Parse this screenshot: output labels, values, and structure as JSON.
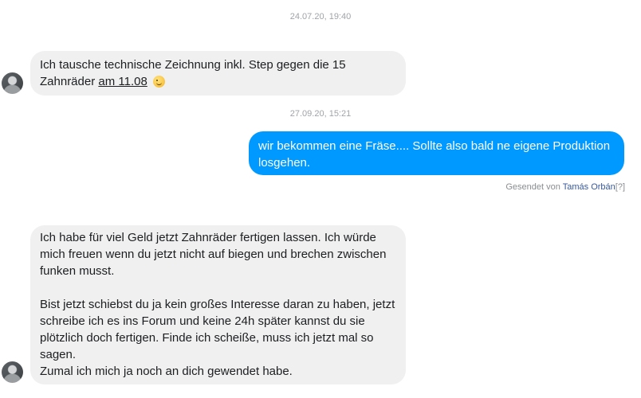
{
  "thread": {
    "timestamp_1": "24.07.20, 19:40",
    "timestamp_2": "27.09.20, 15:21",
    "message_1": {
      "text_before": "Ich tausche technische Zeichnung inkl. Step gegen die 15 Zahnräder ",
      "link_text": "am 11.08",
      "emoji": "wink-emoji"
    },
    "message_2": {
      "text": "wir bekommen eine Fräse.... Sollte also bald ne eigene Produktion losgehen."
    },
    "sent_by": {
      "prefix": "Gesendet von ",
      "name": "Tamás Orbán",
      "help": "[?]"
    },
    "message_3": {
      "paragraph_1": "Ich habe für viel Geld jetzt Zahnräder fertigen lassen. Ich würde mich freuen wenn du jetzt nicht auf biegen und brechen zwischen funken musst.",
      "paragraph_2": "Bist jetzt schiebst du ja kein großes Interesse daran zu haben, jetzt schreibe ich es ins Forum und keine 24h später kannst du sie plötzlich doch fertigen. Finde ich scheiße, muss ich jetzt mal so sagen.",
      "paragraph_3": "Zumal ich mich ja noch an dich gewendet habe."
    }
  },
  "colors": {
    "incoming_bubble": "#f0f0f0",
    "outgoing_bubble": "#0099ff",
    "timestamp_text": "#a0a3a8",
    "name_link": "#385898"
  }
}
